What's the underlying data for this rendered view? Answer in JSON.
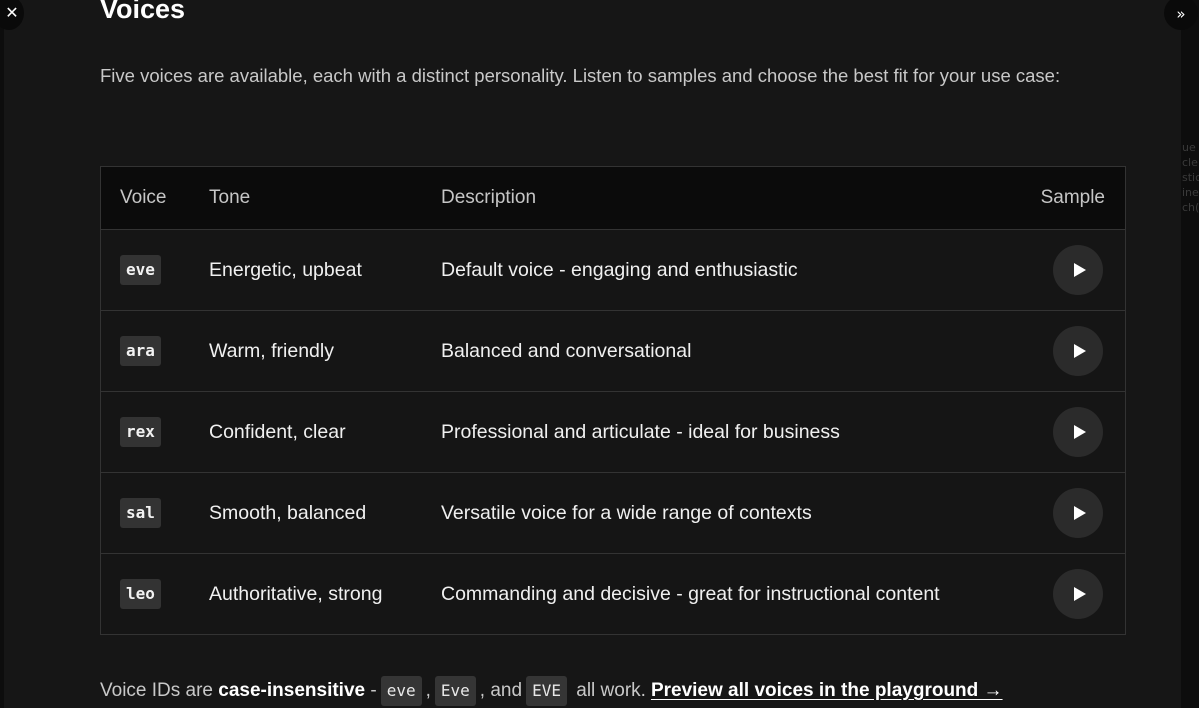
{
  "controls": {
    "close_glyph": "✕",
    "expand_glyph": "»"
  },
  "section": {
    "title": "Voices",
    "intro": "Five voices are available, each with a distinct personality. Listen to samples and choose the best fit for your use case:"
  },
  "table": {
    "headers": {
      "voice": "Voice",
      "tone": "Tone",
      "description": "Description",
      "sample": "Sample"
    },
    "rows": [
      {
        "id": "eve",
        "tone": "Energetic, upbeat",
        "description": "Default voice - engaging and enthusiastic"
      },
      {
        "id": "ara",
        "tone": "Warm, friendly",
        "description": "Balanced and conversational"
      },
      {
        "id": "rex",
        "tone": "Confident, clear",
        "description": "Professional and articulate - ideal for business"
      },
      {
        "id": "sal",
        "tone": "Smooth, balanced",
        "description": "Versatile voice for a wide range of contexts"
      },
      {
        "id": "leo",
        "tone": "Authoritative, strong",
        "description": "Commanding and decisive - great for instructional content"
      }
    ],
    "play_icon": "play-icon"
  },
  "footer": {
    "prefix": "Voice IDs are",
    "bold": "case-insensitive",
    "dash": "-",
    "chip1": "eve",
    "sep1": ",",
    "chip2": "Eve",
    "sep2": ", and",
    "chip3": "EVE",
    "suffix": "all work.",
    "link": "Preview all voices in the playground →"
  },
  "side_panel": {
    "ghost_lines": [
      "ue",
      "cle",
      "stic",
      "ine",
      "ch("
    ]
  }
}
